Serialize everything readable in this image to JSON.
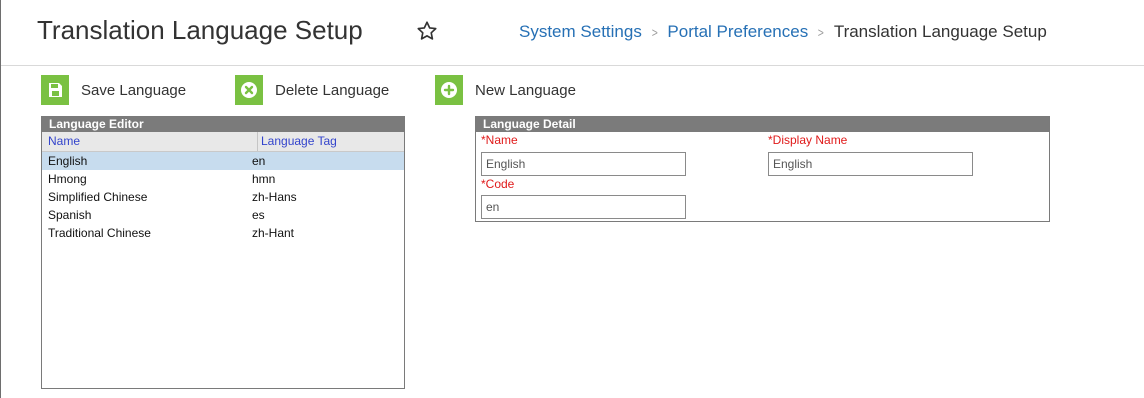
{
  "header": {
    "title": "Translation Language Setup",
    "breadcrumb": [
      "System Settings",
      "Portal Preferences",
      "Translation Language Setup"
    ]
  },
  "toolbar": {
    "save_label": "Save Language",
    "delete_label": "Delete Language",
    "new_label": "New Language"
  },
  "editor": {
    "title": "Language Editor",
    "columns": [
      "Name",
      "Language Tag"
    ],
    "rows": [
      {
        "name": "English",
        "tag": "en"
      },
      {
        "name": "Hmong",
        "tag": "hmn"
      },
      {
        "name": "Simplified Chinese",
        "tag": "zh-Hans"
      },
      {
        "name": "Spanish",
        "tag": "es"
      },
      {
        "name": "Traditional Chinese",
        "tag": "zh-Hant"
      }
    ],
    "selected": "English"
  },
  "detail": {
    "title": "Language Detail",
    "name_label": "*Name",
    "name_value": "English",
    "display_label": "*Display Name",
    "display_value": "English",
    "code_label": "*Code",
    "code_value": "en"
  },
  "colors": {
    "accent_green": "#7ac142",
    "link_blue": "#2670b5",
    "panel_header_gray": "#7b7b7b",
    "selection_blue": "#c7dcee",
    "required_red": "#e01a1a"
  }
}
